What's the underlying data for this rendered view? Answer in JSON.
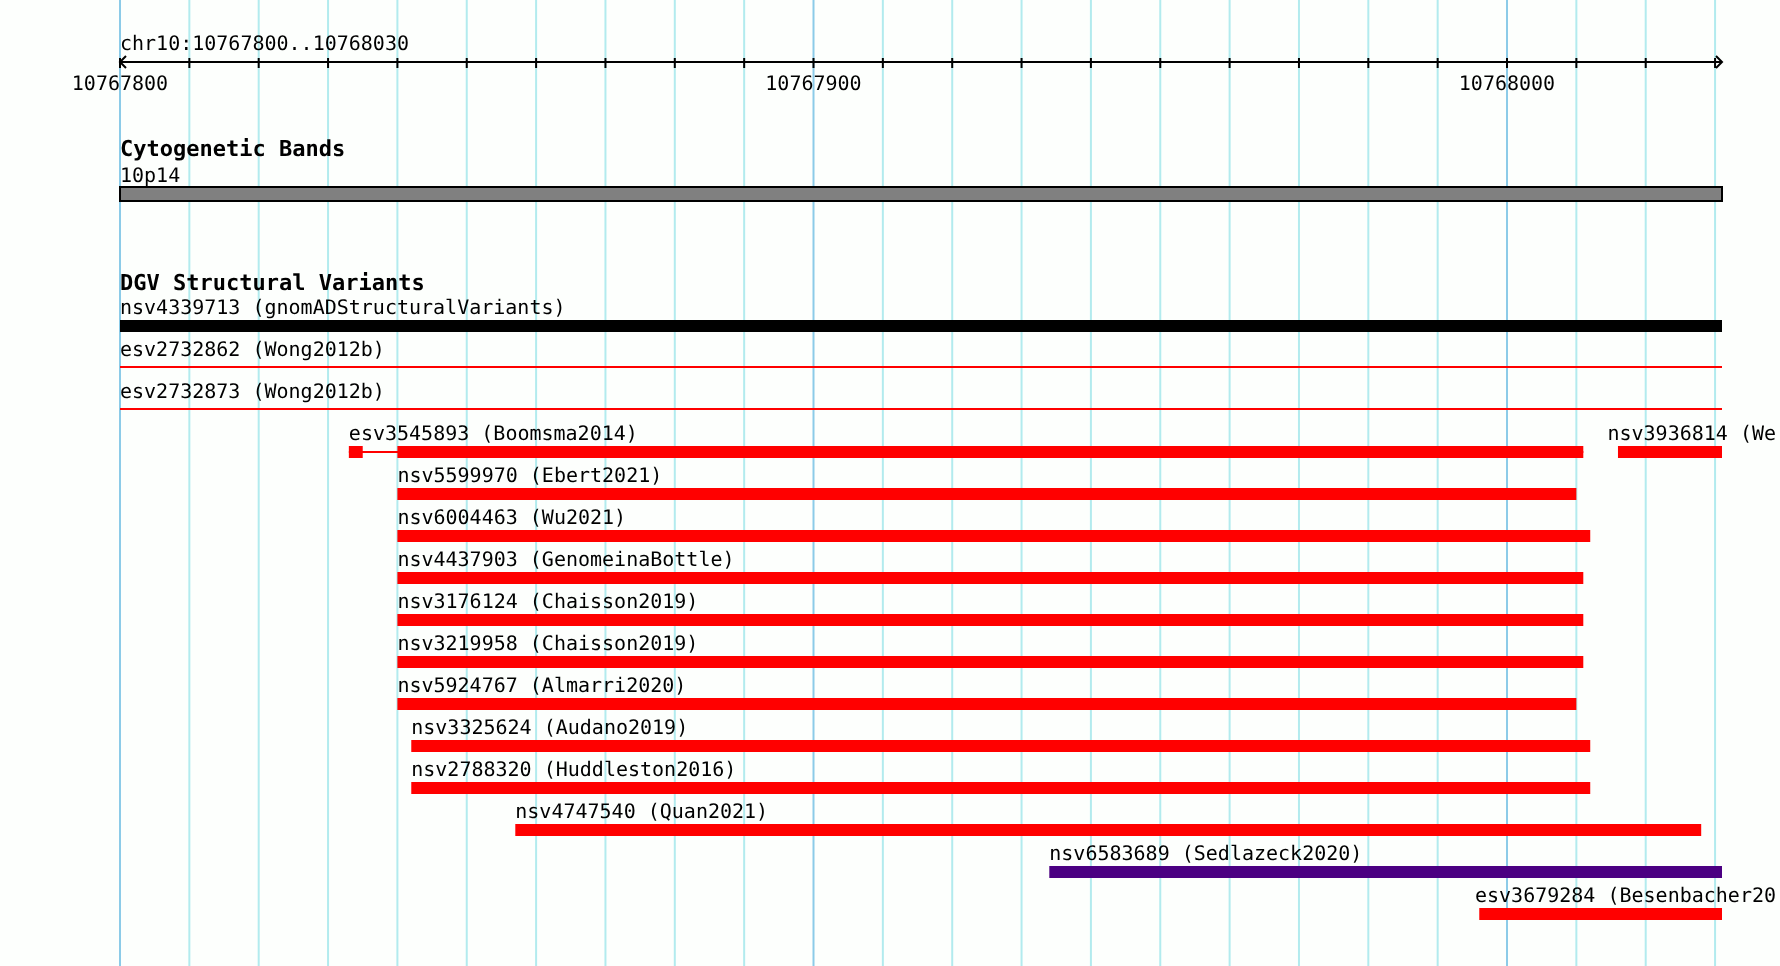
{
  "ruler": {
    "title": "chr10:10767800..10768030",
    "labels": [
      "10767800",
      "10767900",
      "10768000"
    ]
  },
  "tracks": [
    {
      "title": "Cytogenetic Bands",
      "kind": "band",
      "rows": [
        {
          "features": [
            {
              "label": "10p14",
              "kind": "band"
            }
          ]
        }
      ]
    },
    {
      "title": "DGV Structural Variants",
      "kind": "variants",
      "rows": [
        {
          "features": [
            {
              "label": "nsv4339713 (gnomADStructuralVariants)",
              "kind": "bar",
              "color": "#000000"
            }
          ]
        },
        {
          "features": [
            {
              "label": "esv2732862 (Wong2012b)",
              "kind": "line",
              "color": "#ff0000"
            }
          ]
        },
        {
          "features": [
            {
              "label": "esv2732873 (Wong2012b)",
              "kind": "line",
              "color": "#ff0000"
            }
          ]
        },
        {
          "features": [
            {
              "label": "esv3545893 (Boomsma2014)",
              "kind": "split",
              "color": "#ff0000"
            },
            {
              "label": "nsv3936814 (We",
              "kind": "bar",
              "color": "#ff0000"
            }
          ]
        },
        {
          "features": [
            {
              "label": "nsv5599970 (Ebert2021)",
              "kind": "bar",
              "color": "#ff0000"
            }
          ]
        },
        {
          "features": [
            {
              "label": "nsv6004463 (Wu2021)",
              "kind": "bar",
              "color": "#ff0000"
            }
          ]
        },
        {
          "features": [
            {
              "label": "nsv4437903 (GenomeinaBottle)",
              "kind": "bar",
              "color": "#ff0000"
            }
          ]
        },
        {
          "features": [
            {
              "label": "nsv3176124 (Chaisson2019)",
              "kind": "bar",
              "color": "#ff0000"
            }
          ]
        },
        {
          "features": [
            {
              "label": "nsv3219958 (Chaisson2019)",
              "kind": "bar",
              "color": "#ff0000"
            }
          ]
        },
        {
          "features": [
            {
              "label": "nsv5924767 (Almarri2020)",
              "kind": "bar",
              "color": "#ff0000"
            }
          ]
        },
        {
          "features": [
            {
              "label": "nsv3325624 (Audano2019)",
              "kind": "bar",
              "color": "#ff0000"
            }
          ]
        },
        {
          "features": [
            {
              "label": "nsv2788320 (Huddleston2016)",
              "kind": "bar",
              "color": "#ff0000"
            }
          ]
        },
        {
          "features": [
            {
              "label": "nsv4747540 (Quan2021)",
              "kind": "bar",
              "color": "#ff0000"
            }
          ]
        },
        {
          "features": [
            {
              "label": "nsv6583689 (Sedlazeck2020)",
              "kind": "bar",
              "color": "#4b0082"
            }
          ]
        },
        {
          "features": [
            {
              "label": "esv3679284 (Besenbacher20",
              "kind": "bar",
              "color": "#ff0000"
            }
          ]
        }
      ]
    }
  ]
}
